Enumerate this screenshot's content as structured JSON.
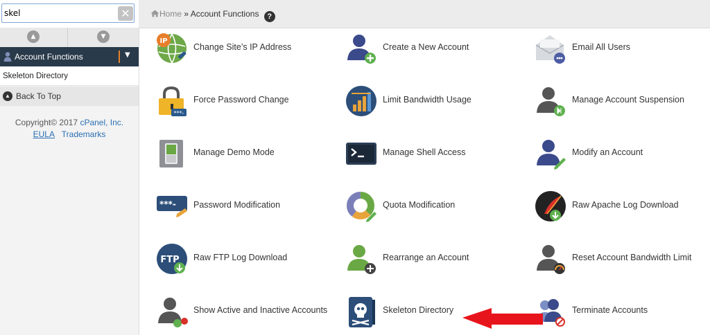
{
  "search": {
    "value": "skel"
  },
  "sidebar": {
    "category": "Account Functions",
    "results": [
      "Skeleton Directory"
    ],
    "back_to_top": "Back To Top",
    "copyright_prefix": "Copyright© 2017",
    "company": "cPanel, Inc.",
    "eula": "EULA",
    "trademarks": "Trademarks"
  },
  "breadcrumb": {
    "home": "Home",
    "separator": "»",
    "current": "Account Functions"
  },
  "tiles": [
    {
      "label": "Change Site’s IP Address",
      "icon": "ip-globe-icon"
    },
    {
      "label": "Create a New Account",
      "icon": "user-add-icon"
    },
    {
      "label": "Email All Users",
      "icon": "envelope-icon"
    },
    {
      "label": "Force Password Change",
      "icon": "padlock-icon"
    },
    {
      "label": "Limit Bandwidth Usage",
      "icon": "bandwidth-chart-icon"
    },
    {
      "label": "Manage Account Suspension",
      "icon": "user-suspend-icon"
    },
    {
      "label": "Manage Demo Mode",
      "icon": "demo-switch-icon"
    },
    {
      "label": "Manage Shell Access",
      "icon": "terminal-icon"
    },
    {
      "label": "Modify an Account",
      "icon": "user-edit-icon"
    },
    {
      "label": "Password Modification",
      "icon": "password-key-icon"
    },
    {
      "label": "Quota Modification",
      "icon": "quota-donut-icon"
    },
    {
      "label": "Raw Apache Log Download",
      "icon": "apache-feather-icon"
    },
    {
      "label": "Raw FTP Log Download",
      "icon": "ftp-download-icon"
    },
    {
      "label": "Rearrange an Account",
      "icon": "user-move-icon"
    },
    {
      "label": "Reset Account Bandwidth Limit",
      "icon": "user-gauge-icon"
    },
    {
      "label": "Show Active and Inactive Accounts",
      "icon": "user-status-icon"
    },
    {
      "label": "Skeleton Directory",
      "icon": "skull-book-icon"
    },
    {
      "label": "Terminate Accounts",
      "icon": "users-terminate-icon"
    }
  ],
  "colors": {
    "sidebar_header": "#293a4a",
    "accent": "#e7812a",
    "link": "#2a6fb3",
    "annotation_arrow": "#e8141b"
  }
}
